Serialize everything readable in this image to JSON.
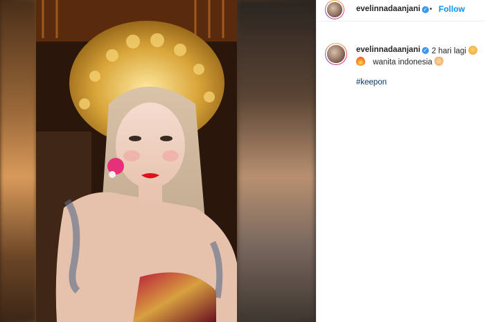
{
  "post": {
    "username": "evelinnadaanjani",
    "follow_label": "Follow",
    "separator": "•",
    "caption_line1": "2 hari lagi",
    "caption_line2": "wanita indonesia",
    "hashtag": "#keepon"
  },
  "icons": {
    "verified": "verified-badge-icon",
    "emoji1": "starstruck-face-emoji",
    "emoji2": "fire-emoji",
    "emoji3": "folded-hands-emoji"
  },
  "colors": {
    "follow": "#0095f6",
    "hashtag": "#00376b",
    "verified": "#3897f0"
  }
}
